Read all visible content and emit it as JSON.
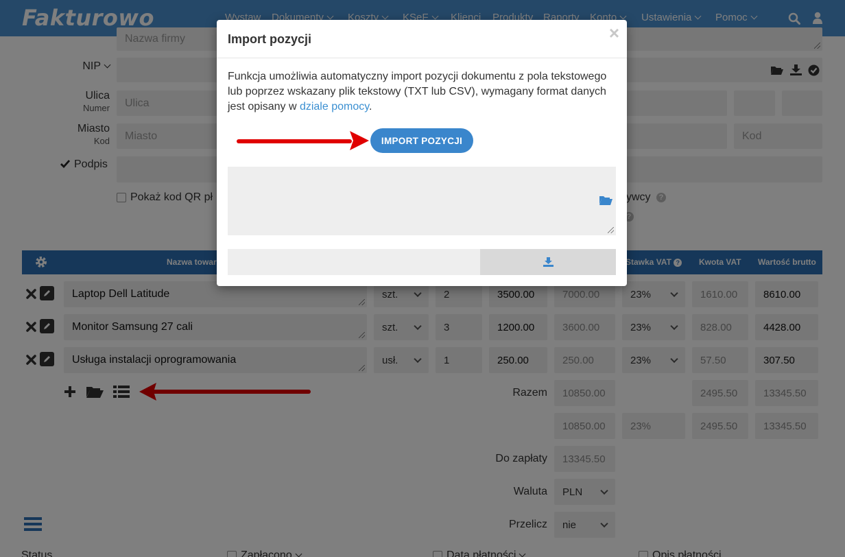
{
  "app": {
    "logo": "Fakturowo"
  },
  "nav": {
    "items": [
      {
        "label": "Wystaw"
      },
      {
        "label": "Dokumenty"
      },
      {
        "label": "Koszty"
      },
      {
        "label": "KSeF"
      },
      {
        "label": "Klienci"
      },
      {
        "label": "Produkty"
      },
      {
        "label": "Raporty"
      },
      {
        "label": "Konto"
      },
      {
        "label": "Ustawienia"
      },
      {
        "label": "Pomoc"
      }
    ],
    "search_icon": "search-icon",
    "user_icon": "user-icon"
  },
  "form": {
    "company_placeholder": "Nazwa firmy",
    "nip_label": "NIP",
    "street_label": "Ulica",
    "street_sub": "Numer",
    "street_placeholder": "Ulica",
    "city_label": "Miasto",
    "city_sub": "Kod",
    "city_placeholder": "Miasto",
    "code_placeholder": "Kod",
    "signature_label": "Podpis",
    "qr_label": "Pokaż kod QR pł",
    "right_label_fragment": "ywcy"
  },
  "table": {
    "headers": {
      "name": "Nazwa towar",
      "vat_rate": "Stawka VAT",
      "vat_amount": "Kwota VAT",
      "gross": "Wartość brutto"
    },
    "rows": [
      {
        "name": "Laptop Dell Latitude",
        "unit": "szt.",
        "qty": "2",
        "price": "3500.00",
        "net": "7000.00",
        "vat": "23%",
        "vat_amount": "1610.00",
        "gross": "8610.00"
      },
      {
        "name": "Monitor Samsung 27 cali",
        "unit": "szt.",
        "qty": "3",
        "price": "1200.00",
        "net": "3600.00",
        "vat": "23%",
        "vat_amount": "828.00",
        "gross": "4428.00"
      },
      {
        "name": "Usługa instalacji oprogramowania",
        "unit": "usł.",
        "qty": "1",
        "price": "250.00",
        "net": "250.00",
        "vat": "23%",
        "vat_amount": "57.50",
        "gross": "307.50"
      }
    ],
    "summary": {
      "total_label": "Razem",
      "total_net": "10850.00",
      "total_vat": "2495.50",
      "total_gross": "13345.50",
      "rate_net": "10850.00",
      "rate": "23%",
      "rate_vat": "2495.50",
      "rate_gross": "13345.50",
      "to_pay_label": "Do zapłaty",
      "to_pay": "13345.50",
      "currency_label": "Waluta",
      "currency": "PLN",
      "recalc_label": "Przelicz",
      "recalc": "nie"
    }
  },
  "bottom": {
    "status": "Status",
    "paid": "Zapłacono",
    "payment_date": "Data płatności",
    "payment_desc": "Opis płatności"
  },
  "modal": {
    "title": "Import pozycji",
    "close": "×",
    "desc_text": "Funkcja umożliwia automatyczny import pozycji dokumentu z pola tekstowego lub poprzez wskazany plik tekstowy (TXT lub CSV), wymagany format danych jest opisany w ",
    "desc_link": "dziale pomocy",
    "desc_end": ".",
    "import_button": "IMPORT POZYCJI"
  },
  "colors": {
    "topbar": "#4a90d0",
    "header": "#2d6fb3",
    "accent": "#3a86cc",
    "arrow": "#e00000"
  }
}
